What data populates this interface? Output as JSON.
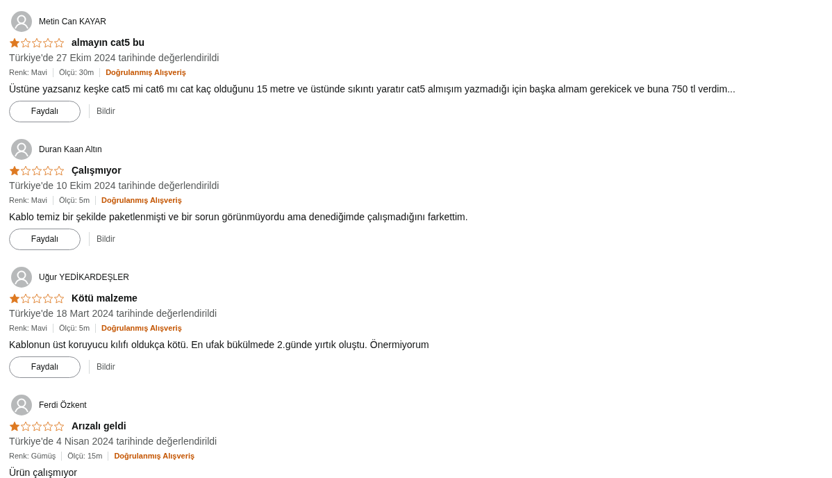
{
  "reviews": [
    {
      "author": "Metin Can KAYAR",
      "stars": 1,
      "title": "almayın cat5 bu",
      "date": "Türkiye'de 27 Ekim 2024 tarihinde değerlendirildi",
      "meta": [
        "Renk: Mavi",
        "Ölçü: 30m"
      ],
      "verified": "Doğrulanmış Alışveriş",
      "body": "Üstüne yazsanız keşke cat5 mi cat6 mı cat kaç olduğunu 15 metre ve üstünde sıkıntı yaratır cat5 almışım yazmadığı için başka almam gerekicek ve buna 750 tl verdim...",
      "helpful": "Faydalı",
      "report": "Bildir"
    },
    {
      "author": "Duran Kaan Altın",
      "stars": 1,
      "title": "Çalışmıyor",
      "date": "Türkiye'de 10 Ekim 2024 tarihinde değerlendirildi",
      "meta": [
        "Renk: Mavi",
        "Ölçü: 5m"
      ],
      "verified": "Doğrulanmış Alışveriş",
      "body": "Kablo temiz bir şekilde paketlenmişti ve bir sorun görünmüyordu ama denediğimde çalışmadığını farkettim.",
      "helpful": "Faydalı",
      "report": "Bildir"
    },
    {
      "author": "Uğur YEDİKARDEŞLER",
      "stars": 1,
      "title": "Kötü malzeme",
      "date": "Türkiye'de 18 Mart 2024 tarihinde değerlendirildi",
      "meta": [
        "Renk: Mavi",
        "Ölçü: 5m"
      ],
      "verified": "Doğrulanmış Alışveriş",
      "body": "Kablonun üst koruyucu kılıfı oldukça kötü. En ufak bükülmede 2.günde yırtık oluştu. Önermiyorum",
      "helpful": "Faydalı",
      "report": "Bildir"
    },
    {
      "author": "Ferdi Özkent",
      "stars": 1,
      "title": "Arızalı geldi",
      "date": "Türkiye'de 4 Nisan 2024 tarihinde değerlendirildi",
      "meta": [
        "Renk: Gümüş",
        "Ölçü: 15m"
      ],
      "verified": "Doğrulanmış Alışveriş",
      "body": "Ürün çalışmıyor"
    }
  ]
}
